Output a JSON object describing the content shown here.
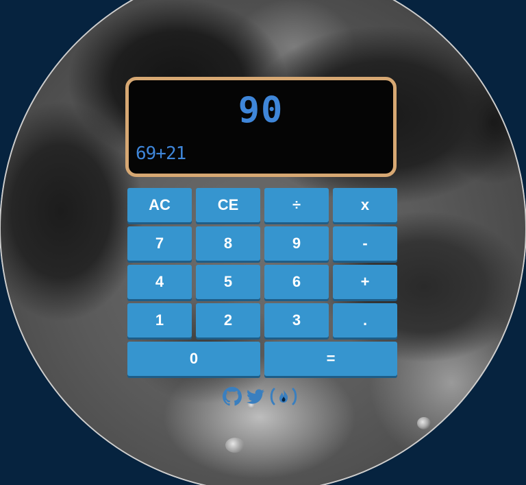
{
  "display": {
    "result": "90",
    "expression": "69+21"
  },
  "keys": {
    "ac": "AC",
    "ce": "CE",
    "divide": "÷",
    "multiply": "x",
    "seven": "7",
    "eight": "8",
    "nine": "9",
    "minus": "-",
    "four": "4",
    "five": "5",
    "six": "6",
    "plus": "+",
    "one": "1",
    "two": "2",
    "three": "3",
    "decimal": ".",
    "zero": "0",
    "equals": "="
  },
  "footer": {
    "icons": [
      "github-icon",
      "twitter-icon",
      "freecodecamp-icon"
    ]
  },
  "colors": {
    "background": "#06233f",
    "display_border": "#d7a873",
    "display_text": "#3f86d9",
    "key": "#3695cf",
    "icon": "#3a7fbf"
  }
}
